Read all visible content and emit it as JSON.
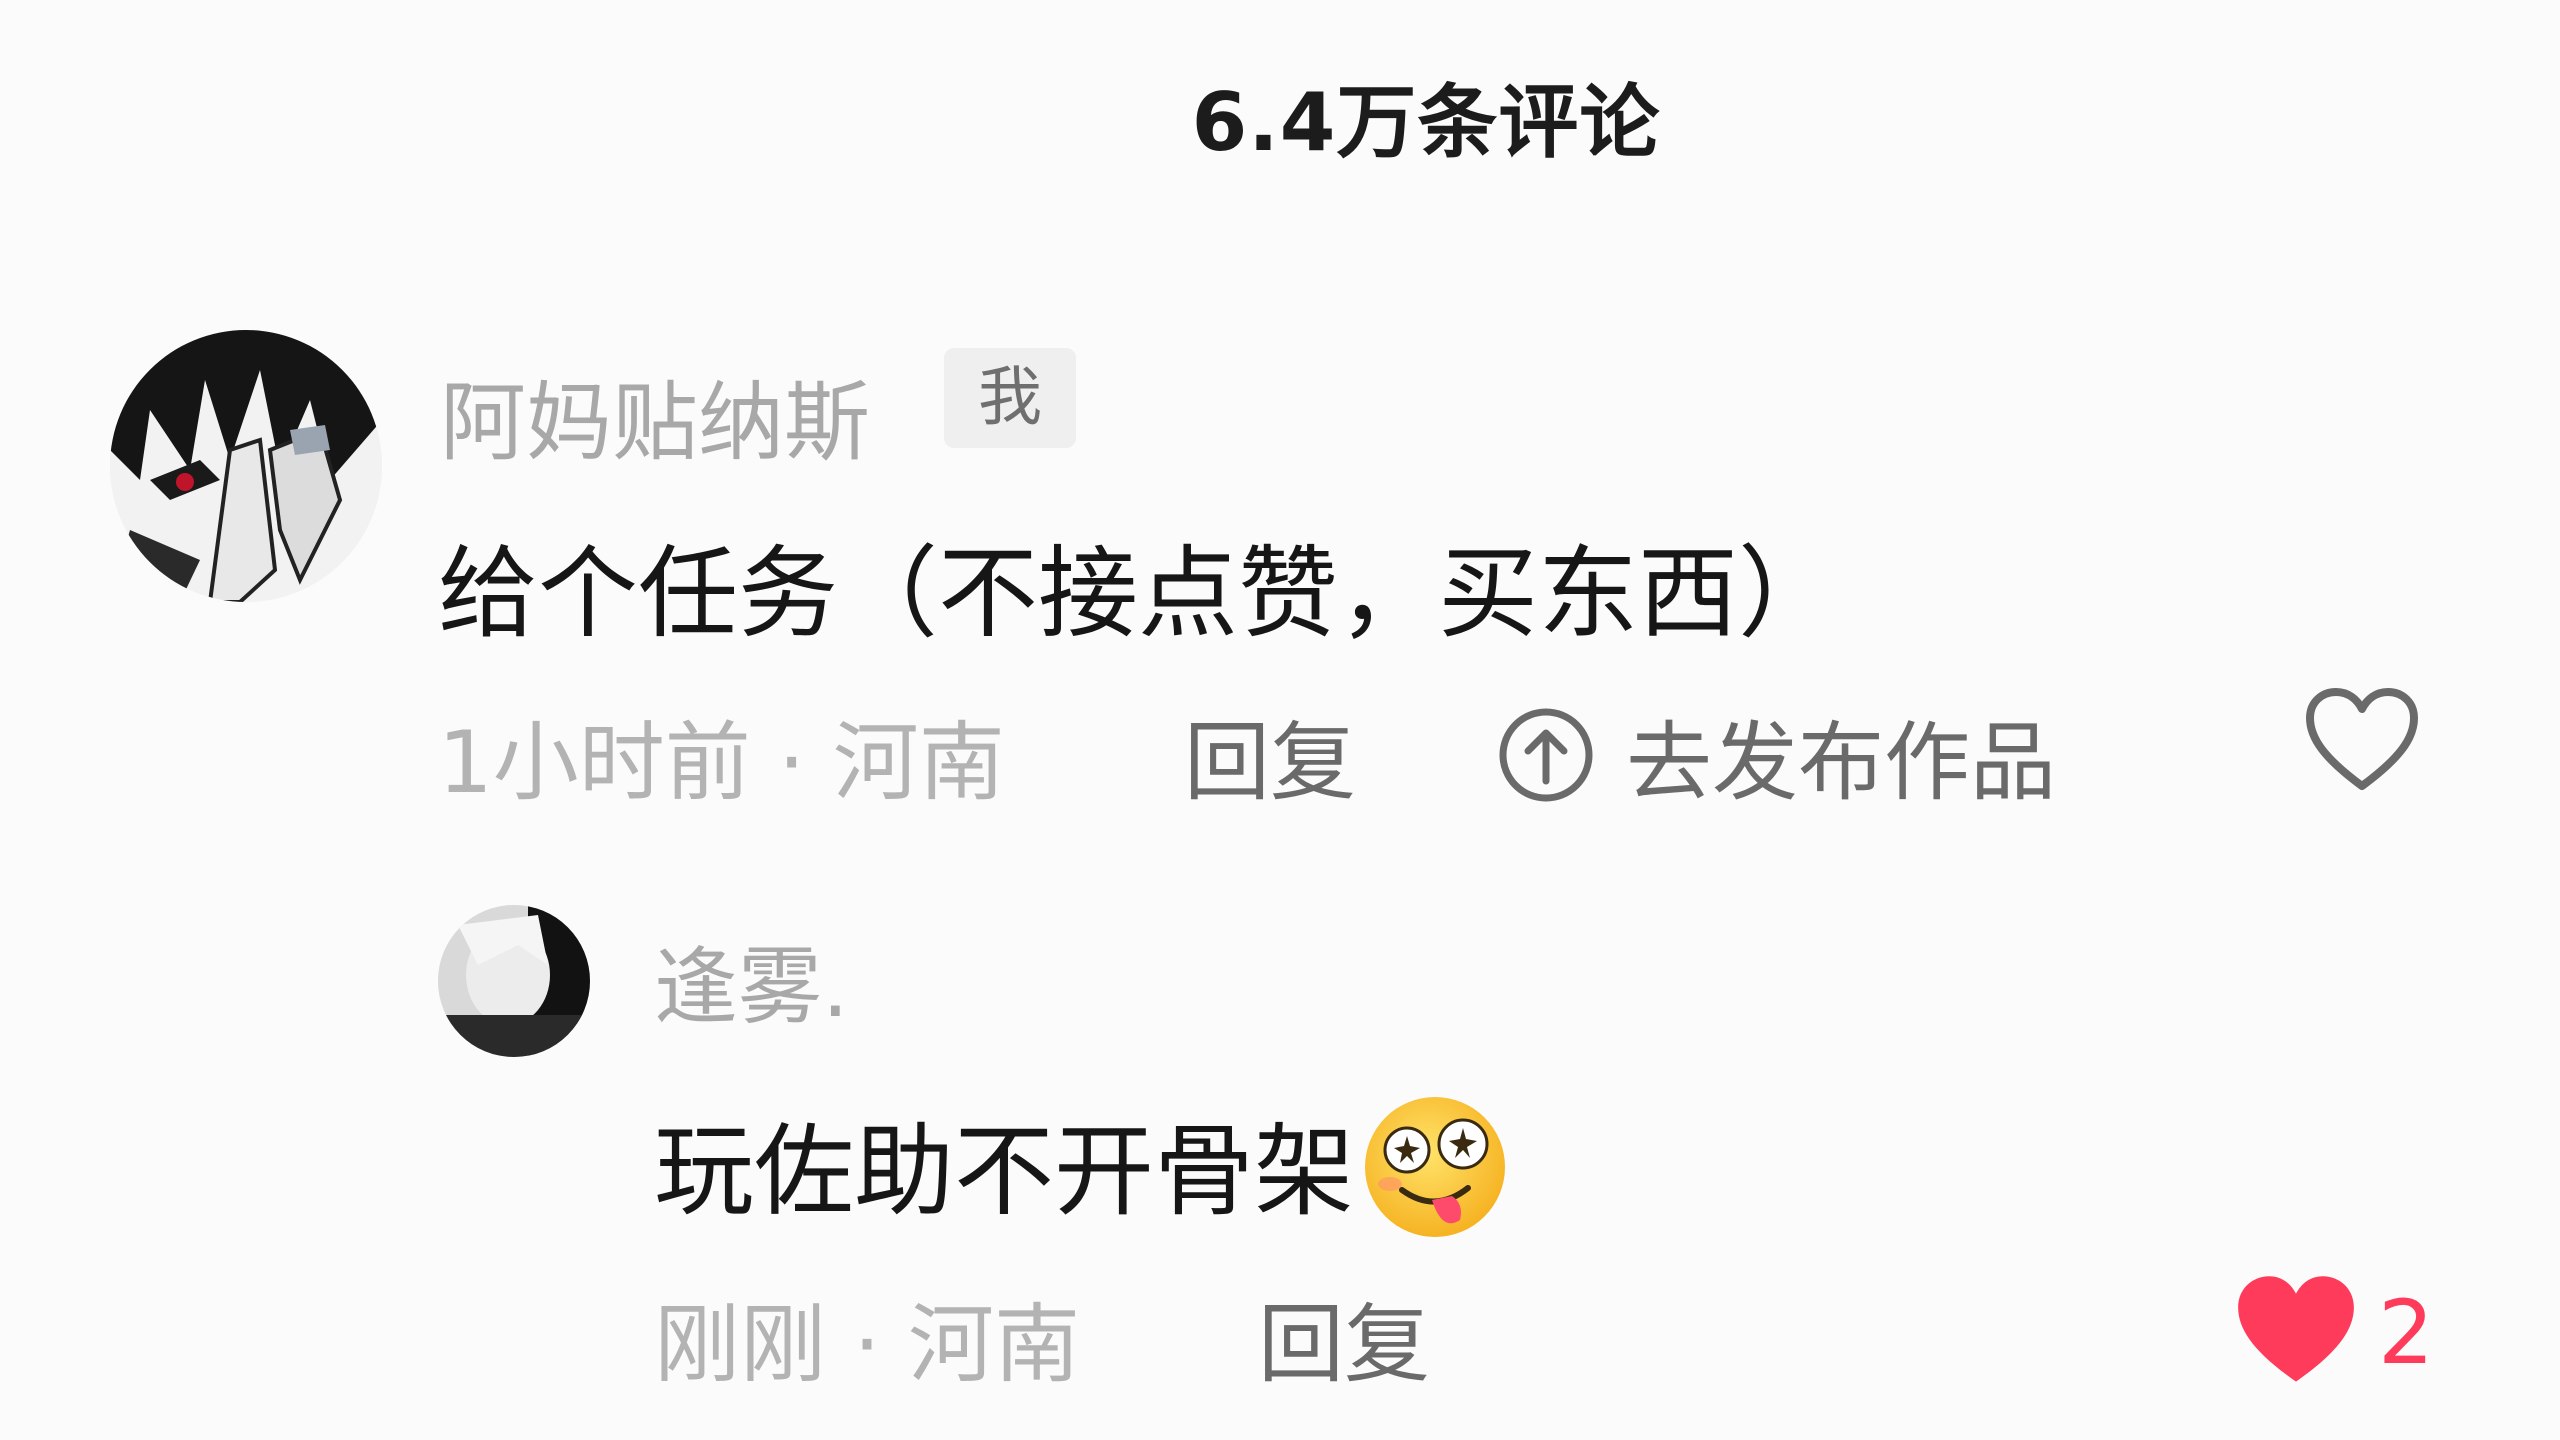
{
  "header": {
    "title": "6.4万条评论"
  },
  "comment": {
    "username": "阿妈贴纳斯",
    "badge": "我",
    "text": "给个任务（不接点赞，买东西）",
    "time_location": "1小时前 · 河南",
    "reply_label": "回复",
    "publish_label": "去发布作品",
    "liked": false
  },
  "reply": {
    "username": "逢雾.",
    "text": "玩佐助不开骨架",
    "emoji": "drooling-star-eyes-emoji",
    "time_location": "刚刚 · 河南",
    "reply_label": "回复",
    "like_count": "2",
    "liked": true
  },
  "colors": {
    "background": "#fbfbfb",
    "like_red": "#ff3b5c",
    "muted_text": "#b3b3b3"
  }
}
